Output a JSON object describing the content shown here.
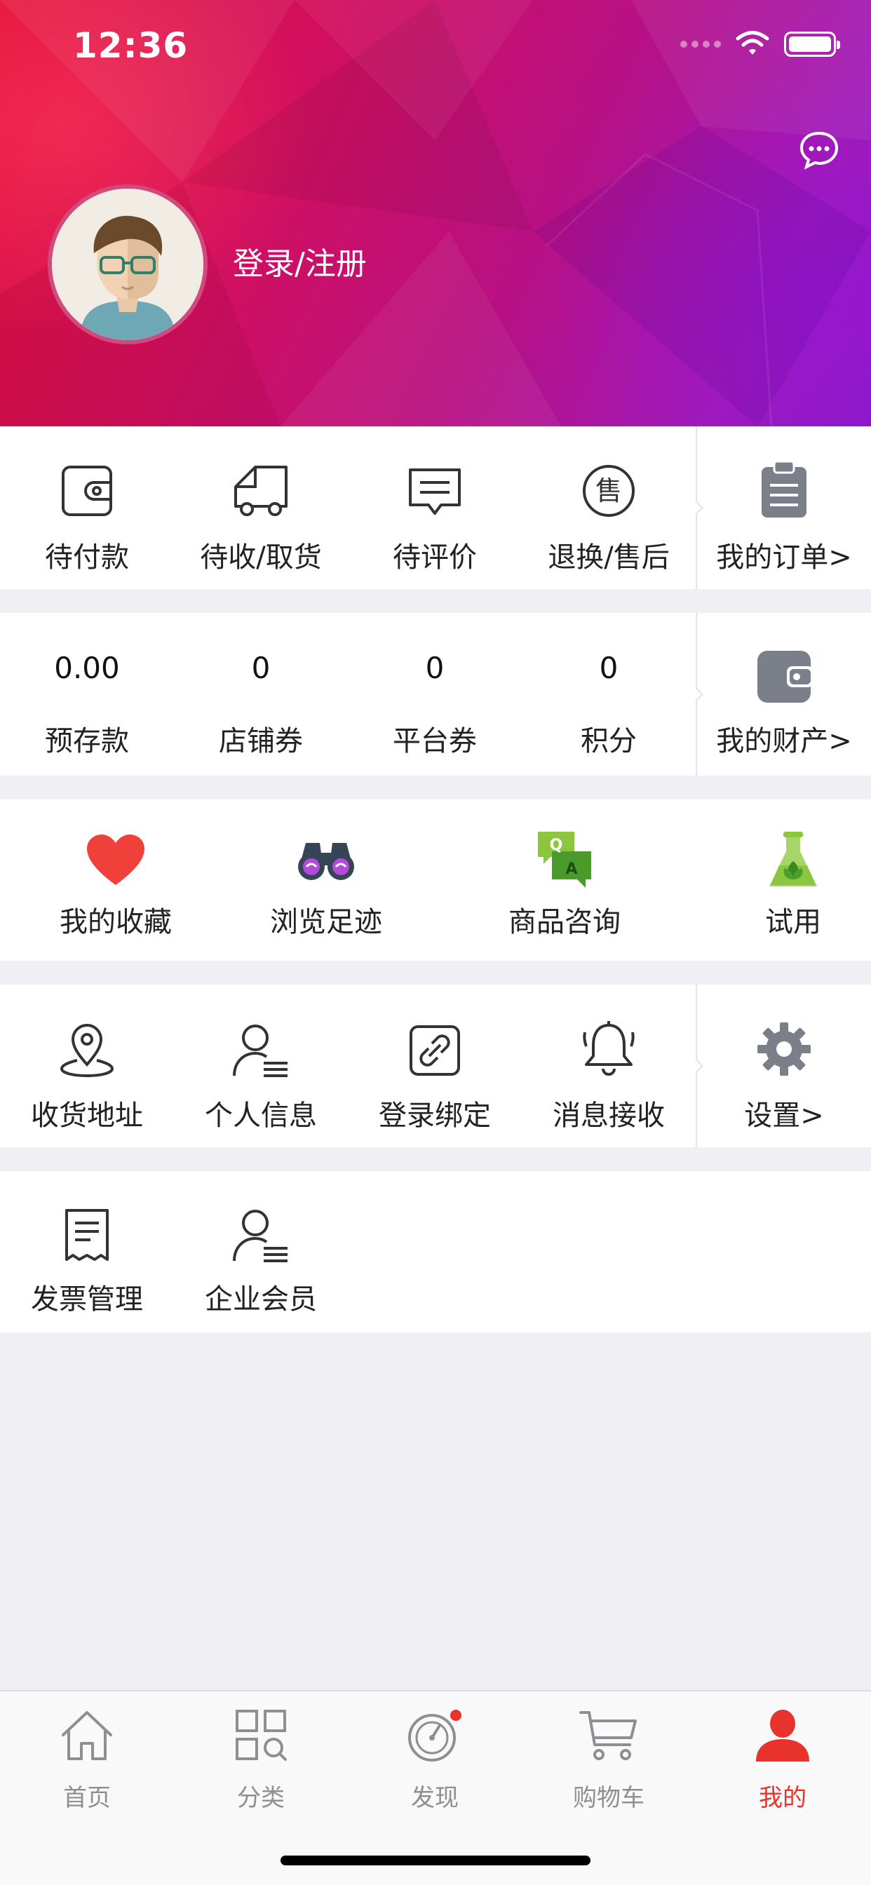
{
  "status_bar": {
    "time": "12:36"
  },
  "header": {
    "login_label": "登录/注册",
    "gradient_start": "#e3143c",
    "gradient_end": "#8a19c9"
  },
  "orders": {
    "items": [
      {
        "label": "待付款",
        "icon": "wallet-icon"
      },
      {
        "label": "待收/取货",
        "icon": "truck-icon"
      },
      {
        "label": "待评价",
        "icon": "comment-icon"
      },
      {
        "label": "退换/售后",
        "icon": "after-sale-icon"
      }
    ],
    "summary": {
      "label": "我的订单>",
      "icon": "clipboard-icon"
    }
  },
  "assets": {
    "items": [
      {
        "value": "0.00",
        "label": "预存款"
      },
      {
        "value": "0",
        "label": "店铺券"
      },
      {
        "value": "0",
        "label": "平台券"
      },
      {
        "value": "0",
        "label": "积分"
      }
    ],
    "summary": {
      "label": "我的财产>",
      "icon": "wallet-filled-icon"
    }
  },
  "quick": {
    "items": [
      {
        "label": "我的收藏",
        "icon": "heart-icon"
      },
      {
        "label": "浏览足迹",
        "icon": "binoculars-icon"
      },
      {
        "label": "商品咨询",
        "icon": "qa-icon"
      },
      {
        "label": "试用",
        "icon": "flask-icon"
      }
    ],
    "qa_q": "Q",
    "qa_a": "A"
  },
  "settings_row": {
    "items": [
      {
        "label": "收货地址",
        "icon": "location-icon"
      },
      {
        "label": "个人信息",
        "icon": "user-info-icon"
      },
      {
        "label": "登录绑定",
        "icon": "link-icon"
      },
      {
        "label": "消息接收",
        "icon": "bell-icon"
      }
    ],
    "summary": {
      "label": "设置>",
      "icon": "gear-icon"
    }
  },
  "extra_row": {
    "items": [
      {
        "label": "发票管理",
        "icon": "invoice-icon"
      },
      {
        "label": "企业会员",
        "icon": "enterprise-member-icon"
      }
    ]
  },
  "tabbar": {
    "items": [
      {
        "label": "首页",
        "icon": "home-icon"
      },
      {
        "label": "分类",
        "icon": "category-icon"
      },
      {
        "label": "发现",
        "icon": "discover-icon"
      },
      {
        "label": "购物车",
        "icon": "cart-icon"
      },
      {
        "label": "我的",
        "icon": "profile-icon"
      }
    ],
    "active_color": "#e8332c",
    "inactive_color": "#8e8e93",
    "badge_color": "#e8332c"
  }
}
